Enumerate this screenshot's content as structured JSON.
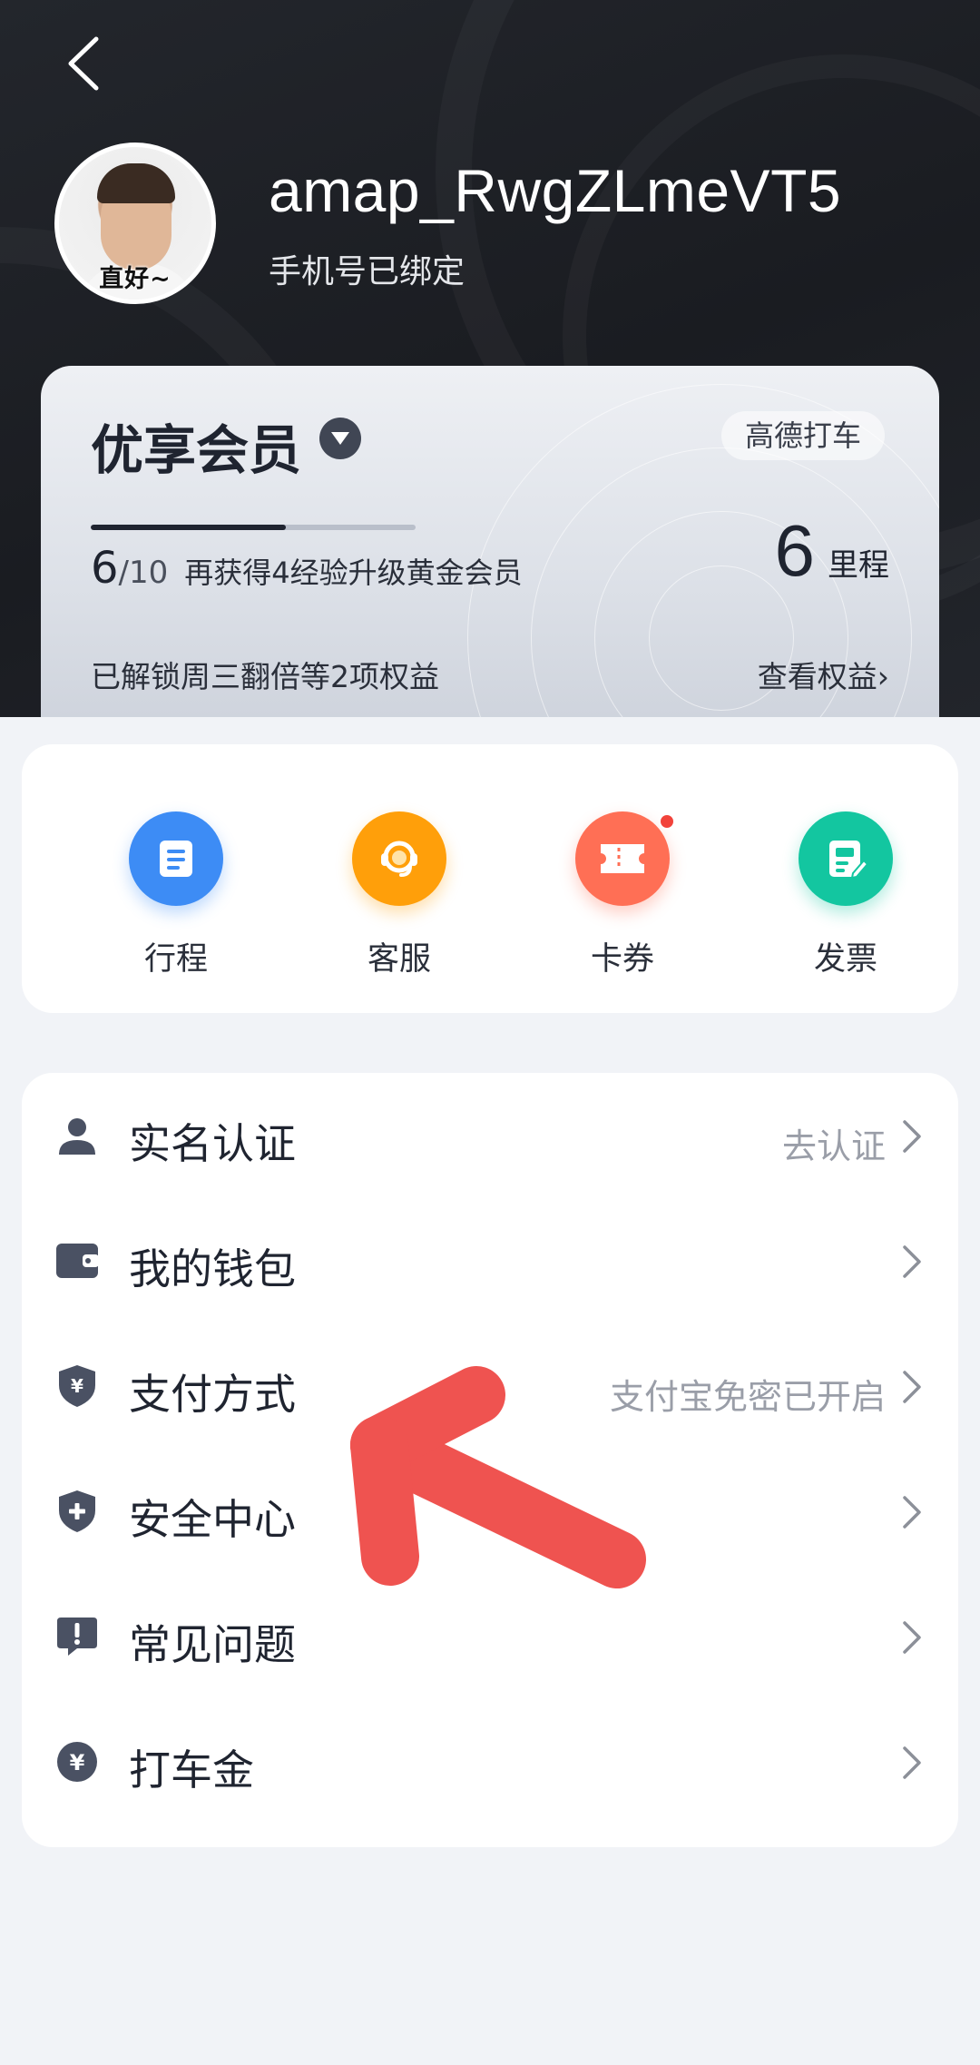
{
  "header": {
    "back_icon": "chevron-left-icon",
    "username": "amap_RwgZLmeVT5",
    "phone_status": "手机号已绑定",
    "avatar_caption": "直好~"
  },
  "member": {
    "title": "优享会员",
    "tag": "高德打车",
    "progress_current": "6",
    "progress_total": "/10",
    "progress_fraction": 0.6,
    "progress_hint": "再获得4经验升级黄金会员",
    "mileage_value": "6",
    "mileage_unit": "里程",
    "unlock_text": "已解锁周三翻倍等2项权益",
    "view_benefits": "查看权益›"
  },
  "quick_actions": [
    {
      "label": "行程",
      "icon": "trip-list-icon",
      "color": "#3d8cf5",
      "badge": false
    },
    {
      "label": "客服",
      "icon": "headset-icon",
      "color": "#ff9f0a",
      "badge": false
    },
    {
      "label": "卡券",
      "icon": "ticket-icon",
      "color": "#ff6f55",
      "badge": true
    },
    {
      "label": "发票",
      "icon": "invoice-icon",
      "color": "#13c6a0",
      "badge": false
    }
  ],
  "menu": [
    {
      "label": "实名认证",
      "value": "去认证",
      "icon": "person-icon"
    },
    {
      "label": "我的钱包",
      "value": "",
      "icon": "wallet-icon"
    },
    {
      "label": "支付方式",
      "value": "支付宝免密已开启",
      "icon": "shield-yen-icon"
    },
    {
      "label": "安全中心",
      "value": "",
      "icon": "shield-plus-icon"
    },
    {
      "label": "常见问题",
      "value": "",
      "icon": "exclamation-chat-icon"
    },
    {
      "label": "打车金",
      "value": "",
      "icon": "coin-icon"
    }
  ],
  "colors": {
    "icon_gray": "#4a5163",
    "annotation_red": "#ef5350"
  }
}
